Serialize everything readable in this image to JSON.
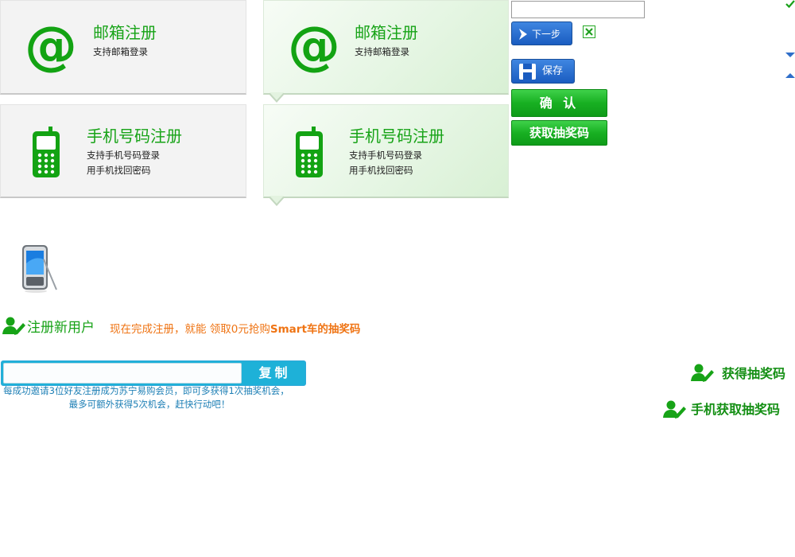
{
  "tiles": [
    {
      "title": "邮箱注册",
      "lines": [
        "支持邮箱登录"
      ]
    },
    {
      "title": "邮箱注册",
      "lines": [
        "支持邮箱登录"
      ]
    },
    {
      "title": "手机号码注册",
      "lines": [
        "支持手机号码登录",
        "用手机找回密码"
      ]
    },
    {
      "title": "手机号码注册",
      "lines": [
        "支持手机号码登录",
        "用手机找回密码"
      ]
    }
  ],
  "at_symbol": "@",
  "form": {
    "input_value": "",
    "next_label": "下一步",
    "save_label": "保存",
    "confirm_label": "确 认",
    "get_code_label": "获取抽奖码"
  },
  "register": {
    "title": "注册新用户",
    "promo_prefix": "现在完成注册，就能 领取0元抢购",
    "promo_bold": "Smart车的抽奖码"
  },
  "invite": {
    "copy_label": "复制",
    "input_value": "",
    "line1": "每成功邀请3位好友注册成为苏宁易购会员，即可多获得1次抽奖机会，",
    "line2": "最多可额外获得5次机会，赶快行动吧！"
  },
  "lottery": {
    "get_label": "获得抽奖码",
    "phone_label": "手机获取抽奖码"
  },
  "colors": {
    "green": "#16a216",
    "blue": "#1a5cc0",
    "orange": "#ef7414",
    "cyan": "#1eb1d8"
  },
  "icons": [
    "at-icon",
    "cell-phone-icon",
    "arrow-right-icon",
    "floppy-disk-icon",
    "close-icon",
    "check-icon",
    "caret-down-icon",
    "caret-up-icon",
    "smartphone-icon",
    "user-edit-icon"
  ]
}
